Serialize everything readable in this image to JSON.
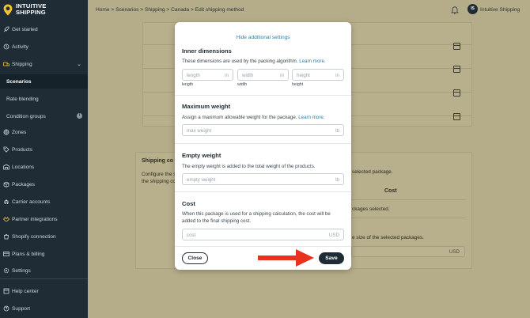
{
  "app": {
    "logo_line1": "INTUITIVE",
    "logo_line2": "SHIPPING"
  },
  "sidebar": {
    "items": [
      {
        "label": "Get started",
        "icon": "rocket-icon"
      },
      {
        "label": "Activity",
        "icon": "activity-icon"
      },
      {
        "label": "Shipping",
        "icon": "truck-icon"
      },
      {
        "label": "Scenarios"
      },
      {
        "label": "Rate blending"
      },
      {
        "label": "Condition groups"
      },
      {
        "label": "Zones",
        "icon": "globe-icon"
      },
      {
        "label": "Products",
        "icon": "tag-icon"
      },
      {
        "label": "Locations",
        "icon": "warehouse-icon"
      },
      {
        "label": "Packages",
        "icon": "box-icon"
      },
      {
        "label": "Carrier accounts",
        "icon": "carrier-icon"
      },
      {
        "label": "Partner integrations",
        "icon": "partner-icon"
      },
      {
        "label": "Shopify connection",
        "icon": "shopify-icon"
      },
      {
        "label": "Plans & billing",
        "icon": "billing-icon"
      },
      {
        "label": "Settings",
        "icon": "gear-icon"
      },
      {
        "label": "Help center",
        "icon": "help-icon"
      },
      {
        "label": "Support",
        "icon": "support-icon"
      }
    ]
  },
  "header": {
    "breadcrumb": "Home > Scenarios > Shipping > Canada > Edit shipping method",
    "user_initials": "IS",
    "user_name": "Intuitive Shipping"
  },
  "background": {
    "card_title": "Shipping co",
    "card_desc_1": "Configure the s",
    "card_desc_2": "the shipping co",
    "right_text_1": "selected package.",
    "cost_header": "Cost",
    "right_text_2": "ckages selected.",
    "right_text_3": "e size of the selected packages.",
    "currency": "USD"
  },
  "modal": {
    "hide_link": "Hide additional settings",
    "inner": {
      "title": "Inner dimensions",
      "desc": "These dimensions are used by the packing algorithm.",
      "learn_more": "Learn more.",
      "length_ph": "length",
      "width_ph": "width",
      "height_ph": "height",
      "unit": "in",
      "length_label": "length",
      "width_label": "width",
      "height_label": "height"
    },
    "max_weight": {
      "title": "Maximum weight",
      "desc": "Assign a maximum allowable weight for the package.",
      "learn_more": "Learn more.",
      "placeholder": "max weight",
      "unit": "lb"
    },
    "empty_weight": {
      "title": "Empty weight",
      "desc": "The empty weight is added to the total weight of the products.",
      "placeholder": "empty weight",
      "unit": "lb"
    },
    "cost": {
      "title": "Cost",
      "desc_1": "When this package is used for a shipping calculation, the cost will be",
      "desc_2": "added to the final shipping cost.",
      "placeholder": "cost",
      "unit": "USD"
    },
    "close_label": "Close",
    "save_label": "Save"
  },
  "colors": {
    "sidebar_bg": "#1f2c35",
    "overlay_bg": "#b5ad8a",
    "link": "#2f7fa3",
    "arrow": "#e8321f"
  }
}
